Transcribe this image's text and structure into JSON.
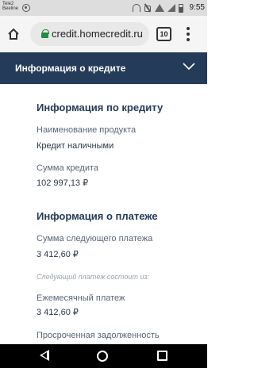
{
  "status_bar": {
    "carrier_line1": "Tele2",
    "carrier_line2": "Beeline",
    "time": "9:55",
    "icons": [
      "notification-icon",
      "headset-icon",
      "mute-icon",
      "wifi-icon",
      "signal-icon",
      "battery-icon"
    ]
  },
  "browser": {
    "url": "credit.homecredit.ru",
    "tab_count": "10",
    "icons": [
      "home-icon",
      "lock-icon",
      "more-vert-icon"
    ],
    "secure_color": "#1e8e3e"
  },
  "header": {
    "title": "Информация о кредите",
    "background": "#253b5a",
    "expand_icon": "chevron-down-icon"
  },
  "credit_info": {
    "heading": "Информация по кредиту",
    "product_label": "Наименование продукта",
    "product_value": "Кредит наличными",
    "amount_label": "Сумма кредита",
    "amount_value": "102 997,13 ₽"
  },
  "payment_info": {
    "heading": "Информация о платеже",
    "next_payment_label": "Сумма следующего платежа",
    "next_payment_value": "3 412,60 ₽",
    "consists_note": "Следующий платеж состоит из:",
    "monthly_label": "Ежемесячный платеж",
    "monthly_value": "3 412,60 ₽",
    "overdue_label": "Просроченная задолженность"
  },
  "nav": {
    "icons": [
      "back-icon",
      "home-circle-icon",
      "recent-apps-icon"
    ]
  }
}
